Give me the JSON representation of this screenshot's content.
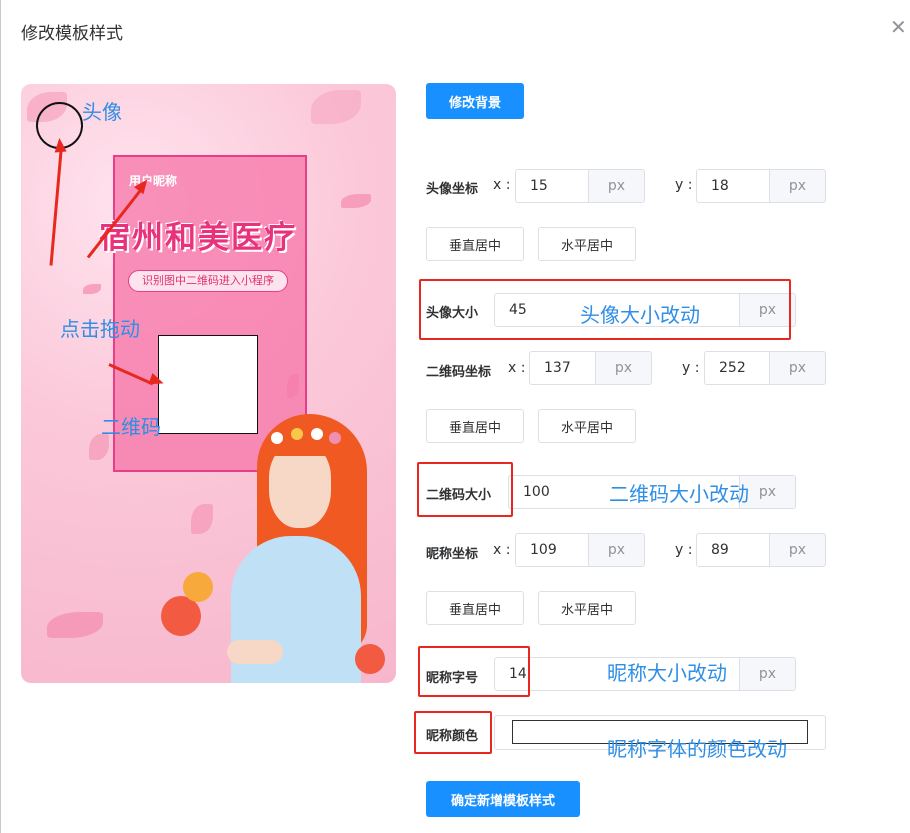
{
  "dialog": {
    "title": "修改模板样式",
    "close_icon": "✕"
  },
  "poster": {
    "nickname": "用户昵称",
    "brand": "宿州和美医疗",
    "scan_hint": "识别图中二维码进入小程序"
  },
  "annotations": {
    "avatar": "头像",
    "drag": "点击拖动",
    "qrcode": "二维码",
    "avatar_size": "头像大小改动",
    "qr_size": "二维码大小改动",
    "nick_size": "昵称大小改动",
    "nick_color": "昵称字体的颜色改动"
  },
  "form": {
    "change_bg": "修改背景",
    "avatar_pos": {
      "label": "头像坐标",
      "x_label": "x :",
      "y_label": "y :",
      "x": "15",
      "y": "18",
      "unit": "px"
    },
    "avatar_center": {
      "vertical": "垂直居中",
      "horizontal": "水平居中"
    },
    "avatar_size": {
      "label": "头像大小",
      "value": "45",
      "unit": "px"
    },
    "qr_pos": {
      "label": "二维码坐标",
      "x_label": "x :",
      "y_label": "y :",
      "x": "137",
      "y": "252",
      "unit": "px"
    },
    "qr_center": {
      "vertical": "垂直居中",
      "horizontal": "水平居中"
    },
    "qr_size": {
      "label": "二维码大小",
      "value": "100",
      "unit": "px"
    },
    "nick_pos": {
      "label": "昵称坐标",
      "x_label": "x :",
      "y_label": "y :",
      "x": "109",
      "y": "89",
      "unit": "px"
    },
    "nick_center": {
      "vertical": "垂直居中",
      "horizontal": "水平居中"
    },
    "nick_size": {
      "label": "昵称字号",
      "value": "14",
      "unit": "px"
    },
    "nick_color": {
      "label": "昵称颜色",
      "value": "#ffffff"
    },
    "submit": "确定新增模板样式"
  },
  "colors": {
    "primary": "#1890ff",
    "annotation_red": "#e8281e",
    "annotation_blue": "#2f8ee6",
    "poster_pink": "#e63e87"
  }
}
